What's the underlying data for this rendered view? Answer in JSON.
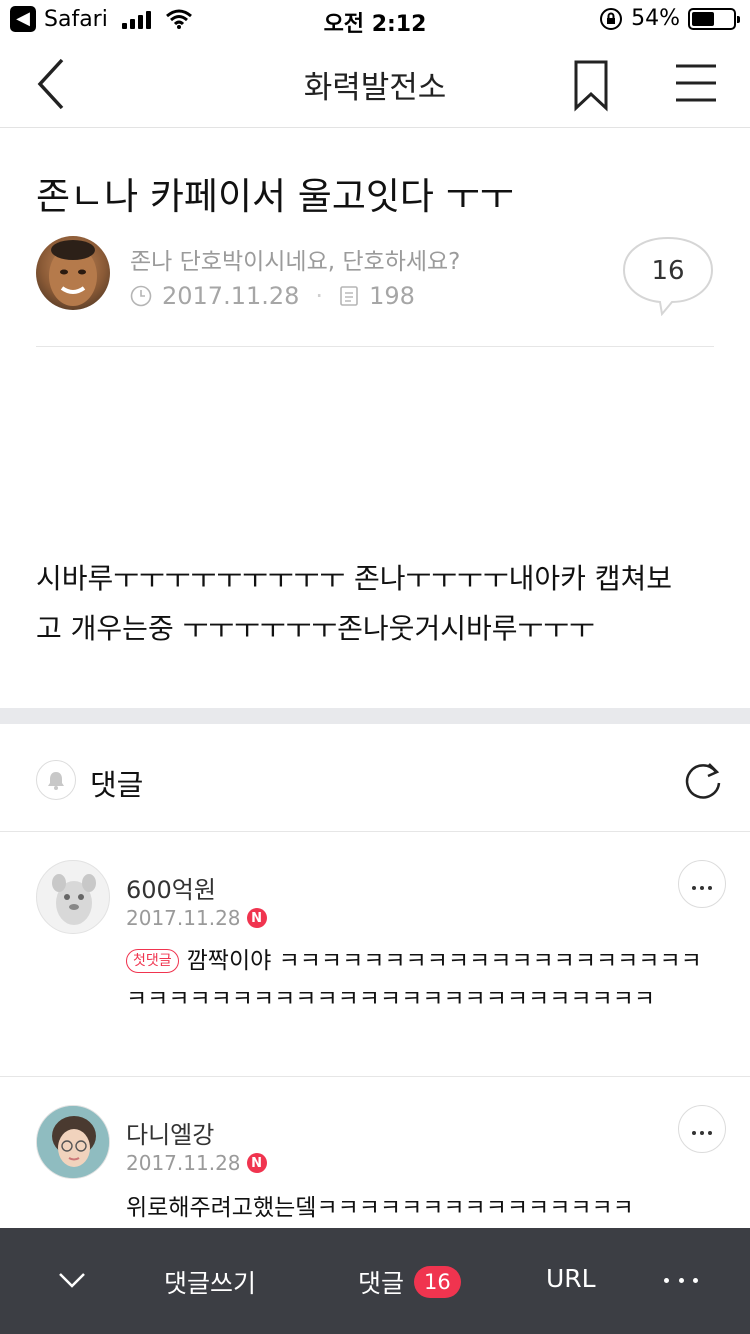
{
  "status_bar": {
    "app": "Safari",
    "time": "오전 2:12",
    "battery": "54%",
    "battery_level": 0.54
  },
  "nav": {
    "title": "화력발전소"
  },
  "post": {
    "title": "존ㄴ나 카페이서 울고잇다 ㅜㅜ",
    "author": "존나 단호박이시네요, 단호하세요?",
    "date": "2017.11.28",
    "views": "198",
    "comment_count": "16",
    "body_lines": [
      "시바루ㅜㅜㅜㅜㅜㅜㅜㅜㅜ 존나ㅜㅜㅜㅜ내아카 캡쳐보",
      "고 개우는중 ㅜㅜㅜㅜㅜㅜ존나웃거시바루ㅜㅜㅜ"
    ]
  },
  "comments_section": {
    "label": "댓글",
    "items": [
      {
        "name": "600억원",
        "date": "2017.11.28",
        "new_badge": "N",
        "first_badge": "첫댓글",
        "text": "깜짝이야 ㅋㅋㅋㅋㅋㅋㅋㅋㅋㅋㅋㅋㅋㅋㅋㅋㅋㅋㅋㅋㅋㅋㅋㅋㅋㅋㅋㅋㅋㅋㅋㅋㅋㅋㅋㅋㅋㅋㅋㅋㅋㅋㅋㅋㅋ"
      },
      {
        "name": "다니엘강",
        "date": "2017.11.28",
        "new_badge": "N",
        "text": "위로해주려고했는뎈ㅋㅋㅋㅋㅋㅋㅋㅋㅋㅋㅋㅋㅋㅋㅋ"
      }
    ]
  },
  "bottom_bar": {
    "write_label": "댓글쓰기",
    "comments_label": "댓글",
    "comments_count": "16",
    "url_label": "URL"
  },
  "icons": {
    "back": "chevron-left-icon",
    "bookmark": "bookmark-icon",
    "menu": "hamburger-menu-icon",
    "clock": "clock-icon",
    "views": "document-icon",
    "bell": "bell-icon",
    "refresh": "refresh-icon",
    "more": "more-horizontal-icon",
    "collapse": "chevron-down-icon"
  },
  "colors": {
    "accent_red": "#f0344f",
    "toolbar_bg": "#3c3e44"
  }
}
